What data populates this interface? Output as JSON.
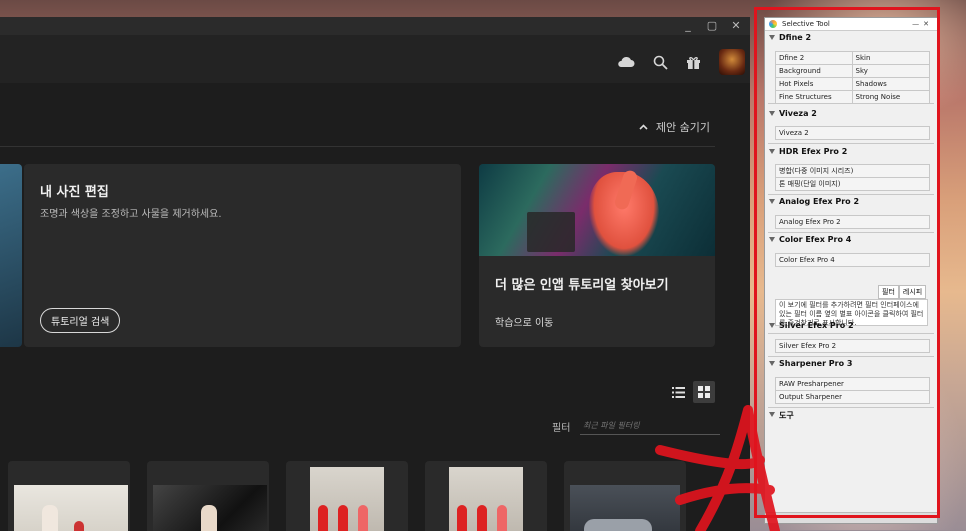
{
  "app": {
    "window_controls": [
      "_",
      "▢",
      "✕"
    ],
    "topbar_icons": [
      "cloud-icon",
      "search-icon",
      "gift-icon",
      "avatar"
    ],
    "hide_suggestions": "제안 숨기기",
    "edit_card": {
      "title": "내 사진 편집",
      "description": "조명과 색상을 조정하고 사물을 제거하세요.",
      "button": "튜토리얼 검색"
    },
    "tutorial_card": {
      "title": "더 많은 인앱 튜토리얼 찾아보기",
      "link": "학습으로 이동"
    },
    "filter": {
      "label": "필터",
      "placeholder": "최근 파일 필터링"
    },
    "view_mode": "grid"
  },
  "selective_tool": {
    "title": "Selective Tool",
    "sections": {
      "dfine": {
        "header": "Dfine 2",
        "items": [
          "Dfine 2",
          "Skin",
          "Background",
          "Sky",
          "Hot Pixels",
          "Shadows",
          "Fine Structures",
          "Strong Noise"
        ]
      },
      "viveza": {
        "header": "Viveza 2",
        "items": [
          "Viveza 2"
        ]
      },
      "hdr": {
        "header": "HDR Efex Pro 2",
        "items": [
          "병합(다중 이미지 시리즈)",
          "톤 매핑(단일 이미지)"
        ]
      },
      "analog": {
        "header": "Analog Efex Pro 2",
        "items": [
          "Analog Efex Pro 2"
        ]
      },
      "color": {
        "header": "Color Efex Pro 4",
        "items": [
          "Color Efex Pro 4"
        ],
        "tabs": [
          "필터",
          "레시피"
        ],
        "help": "이 보기에 필터를 추가하려면 필터 인터페이스에 있는 필터 이름 옆의 별표 아이콘을 클릭하여 필터를 즐겨찾기로 표시합니다."
      },
      "silver": {
        "header": "Silver Efex Pro 2",
        "items": [
          "Silver Efex Pro 2"
        ]
      },
      "sharpener": {
        "header": "Sharpener Pro 3",
        "items": [
          "RAW Presharpener",
          "Output Sharpener"
        ]
      },
      "tools": {
        "header": "도구"
      }
    }
  },
  "colors": {
    "annotation_red": "#e0141d",
    "app_background": "#1d1d1d",
    "card_background": "#2a2a2a"
  }
}
